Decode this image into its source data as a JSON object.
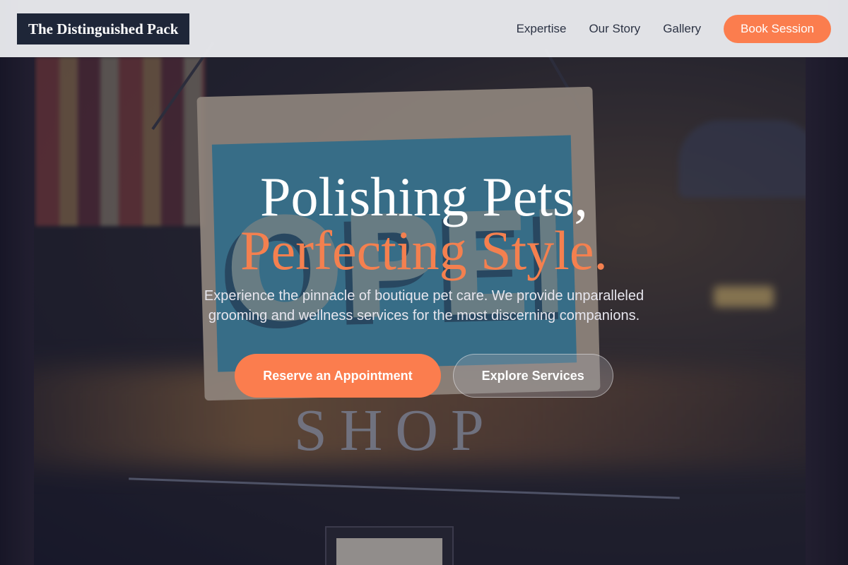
{
  "header": {
    "logo_text": "The Distinguished Pack",
    "nav": [
      {
        "label": "Expertise"
      },
      {
        "label": "Our Story"
      },
      {
        "label": "Gallery"
      }
    ],
    "cta_label": "Book Session"
  },
  "hero": {
    "title_line1": "Polishing Pets,",
    "title_line2": "Perfecting Style.",
    "subtitle": "Experience the pinnacle of boutique pet care. We provide unparalleled grooming and wellness services for the most discerning companions.",
    "primary_button": "Reserve an Appointment",
    "secondary_button": "Explore Services"
  },
  "background": {
    "sign_text": "OPEN",
    "shop_text": "SHOP"
  },
  "colors": {
    "accent": "#fb7d4e",
    "logo_bg": "#1e2638",
    "nav_text": "#2c3344",
    "header_bg": "#f0f1f4"
  }
}
